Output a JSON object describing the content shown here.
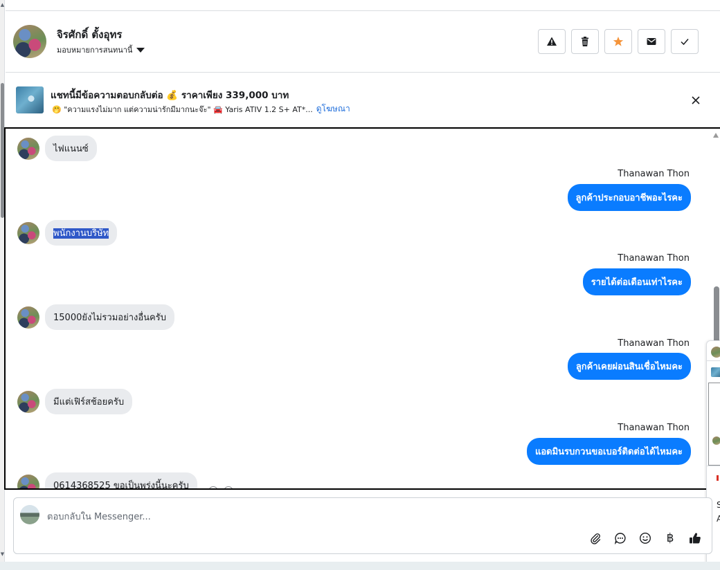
{
  "header": {
    "contact_name": "จิรศักดิ์ ตั้งอุทร",
    "assign_label": "มอบหมายการสนทนานี้",
    "actions": [
      {
        "name": "report-button",
        "icon": "warning-icon"
      },
      {
        "name": "delete-button",
        "icon": "trash-icon"
      },
      {
        "name": "star-button",
        "icon": "star-icon",
        "color": "#f5943a"
      },
      {
        "name": "mark-unread-button",
        "icon": "envelope-icon"
      },
      {
        "name": "mark-done-button",
        "icon": "check-icon"
      }
    ]
  },
  "ad_banner": {
    "title": "แชทนี้มีข้อความตอบกลับต่อ 💰 ราคาเพียง 339,000 บาท",
    "subtitle": "🤭 \"ความแรงไม่มาก แต่ความน่ารักมีมากนะจ๊ะ\" 🚘 Yaris ATIV 1.2 S+ AT*...",
    "link": "ดูโฆษณา"
  },
  "messages": [
    {
      "dir": "in",
      "text": "ไฟแนนซ์"
    },
    {
      "dir": "out",
      "sender": "Thanawan Thon",
      "text": "ลูกค้าประกอบอาชีพอะไรคะ"
    },
    {
      "dir": "in",
      "text": "พนักงานบริษัท",
      "selected": true
    },
    {
      "dir": "out",
      "sender": "Thanawan Thon",
      "text": "รายได้ต่อเดือนเท่าไรคะ"
    },
    {
      "dir": "in",
      "text": "15000ยังไม่รวมอย่างอื่นครับ"
    },
    {
      "dir": "out",
      "sender": "Thanawan Thon",
      "text": "ลูกค้าเคยผ่อนสินเชื่อไหมคะ"
    },
    {
      "dir": "in",
      "text": "มีแต่เฟิร์สช้อยครับ"
    },
    {
      "dir": "out",
      "sender": "Thanawan Thon",
      "text": "แอดมินรบกวนขอเบอร์ติดต่อได้ไหมคะ"
    },
    {
      "dir": "in",
      "text": "0614368525 ขอเป็นพรุ่งนี้นะครับ"
    }
  ],
  "side_card": {
    "line1": "S",
    "line2": "A"
  },
  "composer": {
    "placeholder": "ตอบกลับใน Messenger...",
    "tools": [
      "attach-icon",
      "saved-reply-icon",
      "emoji-icon",
      "baht-icon",
      "thumbs-up-icon"
    ],
    "baht_symbol": "฿"
  },
  "colors": {
    "accent": "#0a7cff",
    "incoming_bubble": "#e9ebee",
    "star": "#f5943a",
    "link": "#216fdb"
  }
}
